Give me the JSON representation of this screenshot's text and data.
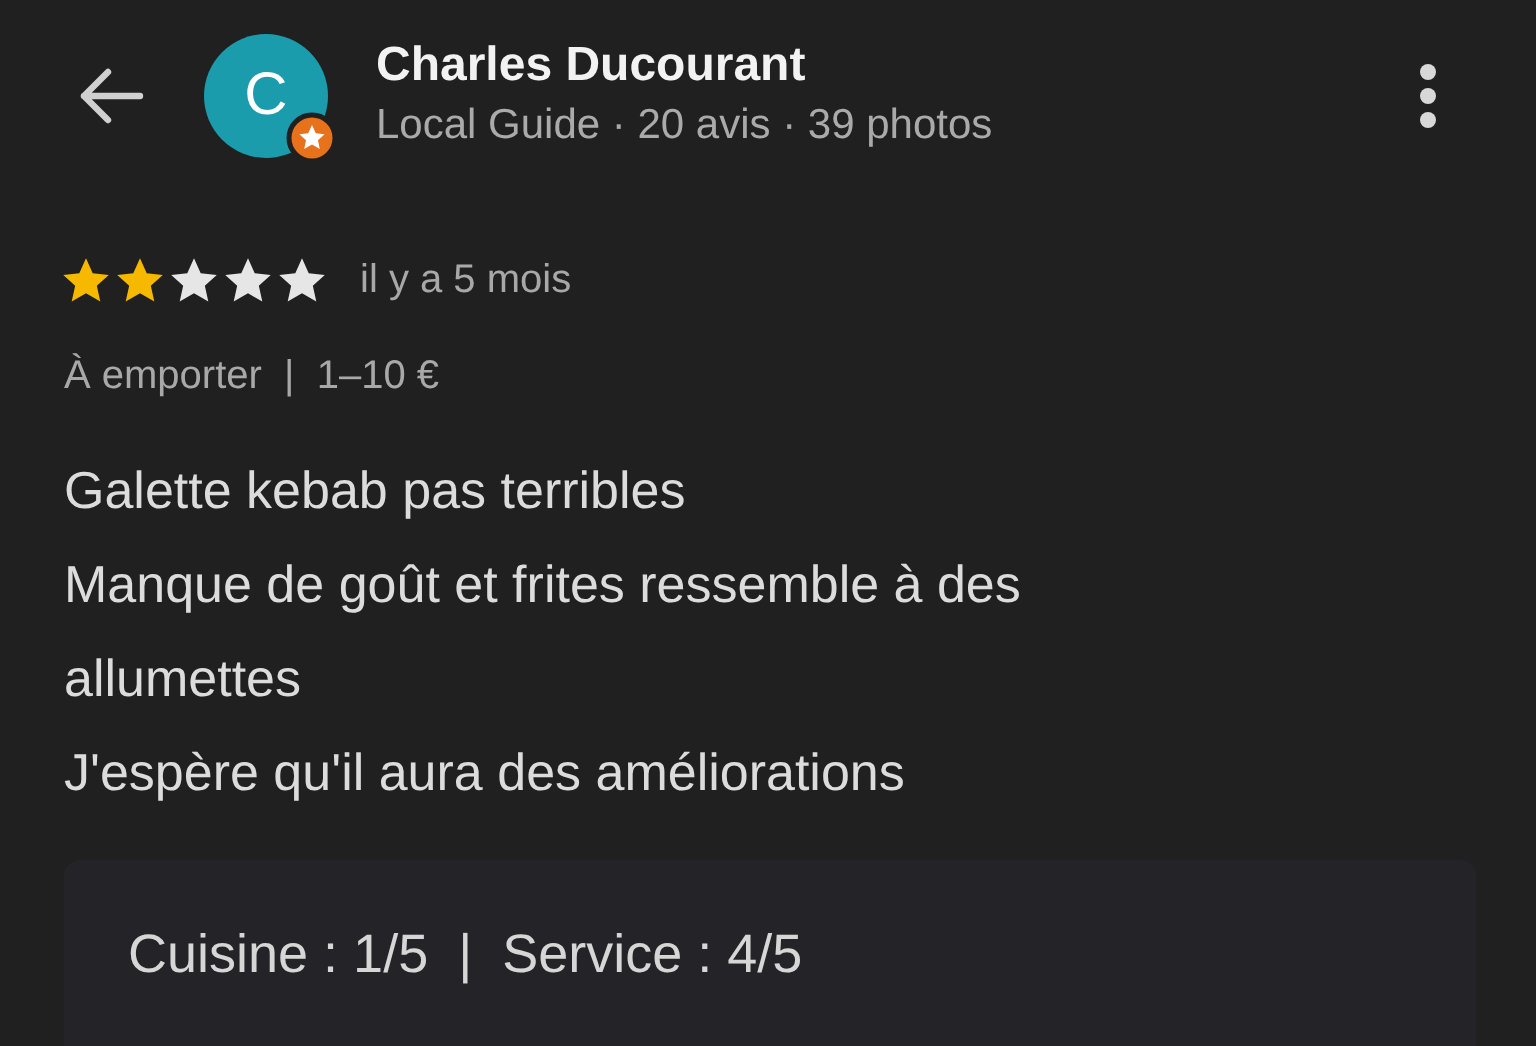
{
  "author": {
    "initial": "C",
    "name": "Charles Ducourant",
    "subtitle": "Local Guide · 20 avis · 39 photos",
    "local_guide": true
  },
  "review": {
    "stars": 2,
    "time": "il y a 5 mois",
    "meta": "À emporter  |  1–10 €",
    "lines": [
      "Galette kebab pas terribles",
      "Manque de goût et frites ressemble à des allumettes",
      "J'espère qu'il aura des améliorations"
    ]
  },
  "ratings_card": {
    "text": "Cuisine : 1/5  |  Service : 4/5"
  }
}
